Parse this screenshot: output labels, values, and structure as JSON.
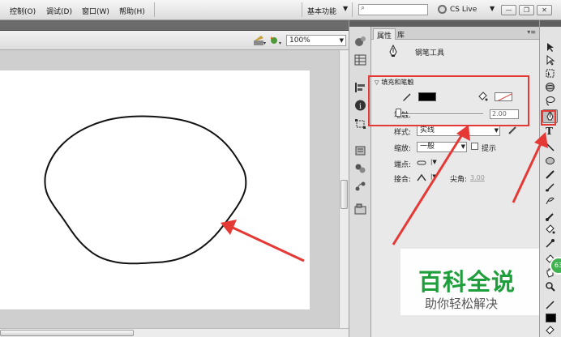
{
  "menubar": {
    "items": [
      "控制(O)",
      "调试(D)",
      "窗口(W)",
      "帮助(H)"
    ],
    "workspace": "基本功能",
    "cs_live": "CS Live"
  },
  "stage": {
    "zoom": "100%"
  },
  "panel": {
    "tabs": [
      "属性",
      "库"
    ],
    "tool_name": "钢笔工具",
    "fill_stroke_section": "填充和笔触",
    "stroke_label": "笔触:",
    "stroke_value": "2.00",
    "style_label": "样式:",
    "style_value": "实线",
    "scale_label": "缩放:",
    "scale_value": "一般",
    "hint_label": "提示",
    "cap_label": "端点:",
    "join_label": "接合:",
    "miter_label": "尖角:",
    "miter_value": "3.00"
  },
  "colors": {
    "stroke": "#000000",
    "annotation_red": "#e53935",
    "watermark_green": "#1f9e3c"
  },
  "watermark": {
    "title": "百科全说",
    "subtitle": "助你轻松解决"
  }
}
